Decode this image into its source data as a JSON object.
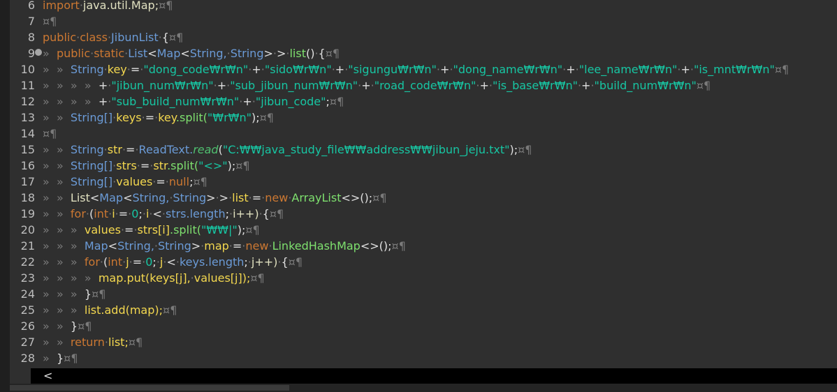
{
  "colors": {
    "background": "#2f2f2f",
    "line_number": "#bdbdbd",
    "keyword": "#cc7832",
    "type": "#6b9bd7",
    "identifier": "#e0e0c0",
    "variable": "#f4d84f",
    "string": "#17c6a3",
    "method": "#7ee06e",
    "whitespace": "#7a7a7a",
    "operator": "#e0e0e0",
    "italic_method": "#4fbf6f"
  },
  "horizontal_scrollbar": {
    "arrow": "<"
  },
  "lines": [
    {
      "n": "6",
      "tokens": [
        [
          "import",
          "kw"
        ],
        [
          "·",
          "ws"
        ],
        [
          "java.util.Map;",
          "id"
        ],
        [
          "¤¶",
          "ws"
        ]
      ]
    },
    {
      "n": "7",
      "tokens": [
        [
          "¤¶",
          "ws"
        ]
      ]
    },
    {
      "n": "8",
      "tokens": [
        [
          "public",
          "kw"
        ],
        [
          "·",
          "ws"
        ],
        [
          "class",
          "kw"
        ],
        [
          "·",
          "ws"
        ],
        [
          "JibunList",
          "ty"
        ],
        [
          "·",
          "ws"
        ],
        [
          "{",
          "op"
        ],
        [
          "¤¶",
          "ws"
        ]
      ]
    },
    {
      "n": "9",
      "fold": true,
      "tokens": [
        [
          "»  ",
          "ws"
        ],
        [
          "public",
          "kw"
        ],
        [
          "·",
          "ws"
        ],
        [
          "static",
          "kw"
        ],
        [
          "·",
          "ws"
        ],
        [
          "List",
          "ty"
        ],
        [
          "<",
          "op"
        ],
        [
          "Map",
          "ty"
        ],
        [
          "<",
          "op"
        ],
        [
          "String,",
          "ty"
        ],
        [
          "·",
          "ws"
        ],
        [
          "String",
          "ty"
        ],
        [
          ">",
          "op"
        ],
        [
          "·",
          "ws"
        ],
        [
          ">",
          "op"
        ],
        [
          "·",
          "ws"
        ],
        [
          "list",
          "me"
        ],
        [
          "()",
          "op"
        ],
        [
          "·",
          "ws"
        ],
        [
          "{",
          "op"
        ],
        [
          "¤¶",
          "ws"
        ]
      ]
    },
    {
      "n": "10",
      "tokens": [
        [
          "»  »  ",
          "ws"
        ],
        [
          "String",
          "ty"
        ],
        [
          "·",
          "ws"
        ],
        [
          "key",
          "va"
        ],
        [
          "·",
          "ws"
        ],
        [
          "=",
          "op"
        ],
        [
          "·",
          "ws"
        ],
        [
          "\"dong_code₩r₩n\"",
          "st"
        ],
        [
          "·",
          "ws"
        ],
        [
          "+",
          "op"
        ],
        [
          "·",
          "ws"
        ],
        [
          "\"sido₩r₩n\"",
          "st"
        ],
        [
          "·",
          "ws"
        ],
        [
          "+",
          "op"
        ],
        [
          "·",
          "ws"
        ],
        [
          "\"sigungu₩r₩n\"",
          "st"
        ],
        [
          "·",
          "ws"
        ],
        [
          "+",
          "op"
        ],
        [
          "·",
          "ws"
        ],
        [
          "\"dong_name₩r₩n\"",
          "st"
        ],
        [
          "·",
          "ws"
        ],
        [
          "+",
          "op"
        ],
        [
          "·",
          "ws"
        ],
        [
          "\"lee_name₩r₩n\"",
          "st"
        ],
        [
          "·",
          "ws"
        ],
        [
          "+",
          "op"
        ],
        [
          "·",
          "ws"
        ],
        [
          "\"is_mnt₩r₩n\"",
          "st"
        ],
        [
          "¤¶",
          "ws"
        ]
      ]
    },
    {
      "n": "11",
      "tokens": [
        [
          "»  »  »  »  ",
          "ws"
        ],
        [
          "+",
          "op"
        ],
        [
          "·",
          "ws"
        ],
        [
          "\"jibun_num₩r₩n\"",
          "st"
        ],
        [
          "·",
          "ws"
        ],
        [
          "+",
          "op"
        ],
        [
          "·",
          "ws"
        ],
        [
          "\"sub_jibun_num₩r₩n\"",
          "st"
        ],
        [
          "·",
          "ws"
        ],
        [
          "+",
          "op"
        ],
        [
          "·",
          "ws"
        ],
        [
          "\"road_code₩r₩n\"",
          "st"
        ],
        [
          "·",
          "ws"
        ],
        [
          "+",
          "op"
        ],
        [
          "·",
          "ws"
        ],
        [
          "\"is_base₩r₩n\"",
          "st"
        ],
        [
          "·",
          "ws"
        ],
        [
          "+",
          "op"
        ],
        [
          "·",
          "ws"
        ],
        [
          "\"build_num₩r₩n\"",
          "st"
        ],
        [
          "¤¶",
          "ws"
        ]
      ]
    },
    {
      "n": "12",
      "tokens": [
        [
          "»  »  »  »  ",
          "ws"
        ],
        [
          "+",
          "op"
        ],
        [
          "·",
          "ws"
        ],
        [
          "\"sub_build_num₩r₩n\"",
          "st"
        ],
        [
          "·",
          "ws"
        ],
        [
          "+",
          "op"
        ],
        [
          "·",
          "ws"
        ],
        [
          "\"jibun_code\"",
          "st"
        ],
        [
          ";",
          "op"
        ],
        [
          "¤¶",
          "ws"
        ]
      ]
    },
    {
      "n": "13",
      "tokens": [
        [
          "»  »  ",
          "ws"
        ],
        [
          "String[]",
          "ty"
        ],
        [
          "·",
          "ws"
        ],
        [
          "keys",
          "va"
        ],
        [
          "·",
          "ws"
        ],
        [
          "=",
          "op"
        ],
        [
          "·",
          "ws"
        ],
        [
          "key",
          "va"
        ],
        [
          ".split(",
          "me"
        ],
        [
          "\"₩r₩n\"",
          "st"
        ],
        [
          ");",
          "op"
        ],
        [
          "¤¶",
          "ws"
        ]
      ]
    },
    {
      "n": "14",
      "tokens": [
        [
          "¤¶",
          "ws"
        ]
      ]
    },
    {
      "n": "15",
      "tokens": [
        [
          "»  »  ",
          "ws"
        ],
        [
          "String",
          "ty"
        ],
        [
          "·",
          "ws"
        ],
        [
          "str",
          "va"
        ],
        [
          "·",
          "ws"
        ],
        [
          "=",
          "op"
        ],
        [
          "·",
          "ws"
        ],
        [
          "ReadText.",
          "ty"
        ],
        [
          "read",
          "it"
        ],
        [
          "(",
          "op"
        ],
        [
          "\"C:₩₩java_study_file₩₩address₩₩jibun_jeju.txt\"",
          "st"
        ],
        [
          ");",
          "op"
        ],
        [
          "¤¶",
          "ws"
        ]
      ]
    },
    {
      "n": "16",
      "tokens": [
        [
          "»  »  ",
          "ws"
        ],
        [
          "String[]",
          "ty"
        ],
        [
          "·",
          "ws"
        ],
        [
          "strs",
          "va"
        ],
        [
          "·",
          "ws"
        ],
        [
          "=",
          "op"
        ],
        [
          "·",
          "ws"
        ],
        [
          "str",
          "va"
        ],
        [
          ".split(",
          "me"
        ],
        [
          "\"<>\"",
          "st"
        ],
        [
          ");",
          "op"
        ],
        [
          "¤¶",
          "ws"
        ]
      ]
    },
    {
      "n": "17",
      "tokens": [
        [
          "»  »  ",
          "ws"
        ],
        [
          "String[]",
          "ty"
        ],
        [
          "·",
          "ws"
        ],
        [
          "values",
          "va"
        ],
        [
          "·",
          "ws"
        ],
        [
          "=",
          "op"
        ],
        [
          "·",
          "ws"
        ],
        [
          "null",
          "kw"
        ],
        [
          ";",
          "op"
        ],
        [
          "¤¶",
          "ws"
        ]
      ]
    },
    {
      "n": "18",
      "tokens": [
        [
          "»  »  ",
          "ws"
        ],
        [
          "List",
          "id"
        ],
        [
          "<",
          "op"
        ],
        [
          "Map",
          "ty"
        ],
        [
          "<",
          "op"
        ],
        [
          "String,",
          "ty"
        ],
        [
          "·",
          "ws"
        ],
        [
          "String",
          "ty"
        ],
        [
          ">",
          "op"
        ],
        [
          "·",
          "ws"
        ],
        [
          ">",
          "op"
        ],
        [
          "·",
          "ws"
        ],
        [
          "list",
          "va"
        ],
        [
          "·",
          "ws"
        ],
        [
          "=",
          "op"
        ],
        [
          "·",
          "ws"
        ],
        [
          "new",
          "kw"
        ],
        [
          "·",
          "ws"
        ],
        [
          "ArrayList",
          "me"
        ],
        [
          "<>();",
          "op"
        ],
        [
          "¤¶",
          "ws"
        ]
      ]
    },
    {
      "n": "19",
      "tokens": [
        [
          "»  »  ",
          "ws"
        ],
        [
          "for",
          "kw"
        ],
        [
          "·",
          "ws"
        ],
        [
          "(",
          "op"
        ],
        [
          "int",
          "kw"
        ],
        [
          "·",
          "ws"
        ],
        [
          "i",
          "va"
        ],
        [
          "·",
          "ws"
        ],
        [
          "=",
          "op"
        ],
        [
          "·",
          "ws"
        ],
        [
          "0",
          "st"
        ],
        [
          ";",
          "op"
        ],
        [
          "·",
          "ws"
        ],
        [
          "i",
          "va"
        ],
        [
          "·",
          "ws"
        ],
        [
          "<",
          "op"
        ],
        [
          "·",
          "ws"
        ],
        [
          "strs.length",
          "ty"
        ],
        [
          ";",
          "op"
        ],
        [
          "·",
          "ws"
        ],
        [
          "i++)",
          "id"
        ],
        [
          "·",
          "ws"
        ],
        [
          "{",
          "op"
        ],
        [
          "¤¶",
          "ws"
        ]
      ]
    },
    {
      "n": "20",
      "tokens": [
        [
          "»  »  »  ",
          "ws"
        ],
        [
          "values",
          "va"
        ],
        [
          "·",
          "ws"
        ],
        [
          "=",
          "op"
        ],
        [
          "·",
          "ws"
        ],
        [
          "strs[i]",
          "va"
        ],
        [
          ".split(",
          "me"
        ],
        [
          "\"₩₩|\"",
          "st"
        ],
        [
          ");",
          "op"
        ],
        [
          "¤¶",
          "ws"
        ]
      ]
    },
    {
      "n": "21",
      "tokens": [
        [
          "»  »  »  ",
          "ws"
        ],
        [
          "Map",
          "ty"
        ],
        [
          "<",
          "op"
        ],
        [
          "String,",
          "ty"
        ],
        [
          "·",
          "ws"
        ],
        [
          "String",
          "ty"
        ],
        [
          ">",
          "op"
        ],
        [
          "·",
          "ws"
        ],
        [
          "map",
          "va"
        ],
        [
          "·",
          "ws"
        ],
        [
          "=",
          "op"
        ],
        [
          "·",
          "ws"
        ],
        [
          "new",
          "kw"
        ],
        [
          "·",
          "ws"
        ],
        [
          "LinkedHashMap",
          "me"
        ],
        [
          "<>();",
          "op"
        ],
        [
          "¤¶",
          "ws"
        ]
      ]
    },
    {
      "n": "22",
      "tokens": [
        [
          "»  »  »  ",
          "ws"
        ],
        [
          "for",
          "kw"
        ],
        [
          "·",
          "ws"
        ],
        [
          "(",
          "op"
        ],
        [
          "int",
          "kw"
        ],
        [
          "·",
          "ws"
        ],
        [
          "j",
          "va"
        ],
        [
          "·",
          "ws"
        ],
        [
          "=",
          "op"
        ],
        [
          "·",
          "ws"
        ],
        [
          "0",
          "st"
        ],
        [
          ";",
          "op"
        ],
        [
          "·",
          "ws"
        ],
        [
          "j",
          "va"
        ],
        [
          "·",
          "ws"
        ],
        [
          "<",
          "op"
        ],
        [
          "·",
          "ws"
        ],
        [
          "keys.length",
          "ty"
        ],
        [
          ";",
          "op"
        ],
        [
          "·",
          "ws"
        ],
        [
          "j++)",
          "id"
        ],
        [
          "·",
          "ws"
        ],
        [
          "{",
          "op"
        ],
        [
          "¤¶",
          "ws"
        ]
      ]
    },
    {
      "n": "23",
      "tokens": [
        [
          "»  »  »  »  ",
          "ws"
        ],
        [
          "map.put(keys[j],",
          "va"
        ],
        [
          "·",
          "ws"
        ],
        [
          "values[j]);",
          "va"
        ],
        [
          "¤¶",
          "ws"
        ]
      ]
    },
    {
      "n": "24",
      "tokens": [
        [
          "»  »  »  ",
          "ws"
        ],
        [
          "}",
          "op"
        ],
        [
          "¤¶",
          "ws"
        ]
      ]
    },
    {
      "n": "25",
      "tokens": [
        [
          "»  »  »  ",
          "ws"
        ],
        [
          "list.add(map);",
          "va"
        ],
        [
          "¤¶",
          "ws"
        ]
      ]
    },
    {
      "n": "26",
      "tokens": [
        [
          "»  »  ",
          "ws"
        ],
        [
          "}",
          "op"
        ],
        [
          "¤¶",
          "ws"
        ]
      ]
    },
    {
      "n": "27",
      "tokens": [
        [
          "»  »  ",
          "ws"
        ],
        [
          "return",
          "kw"
        ],
        [
          "·",
          "ws"
        ],
        [
          "list;",
          "va"
        ],
        [
          "¤¶",
          "ws"
        ]
      ]
    },
    {
      "n": "28",
      "tokens": [
        [
          "»  ",
          "ws"
        ],
        [
          "}",
          "op"
        ],
        [
          "¤¶",
          "ws"
        ]
      ]
    }
  ]
}
